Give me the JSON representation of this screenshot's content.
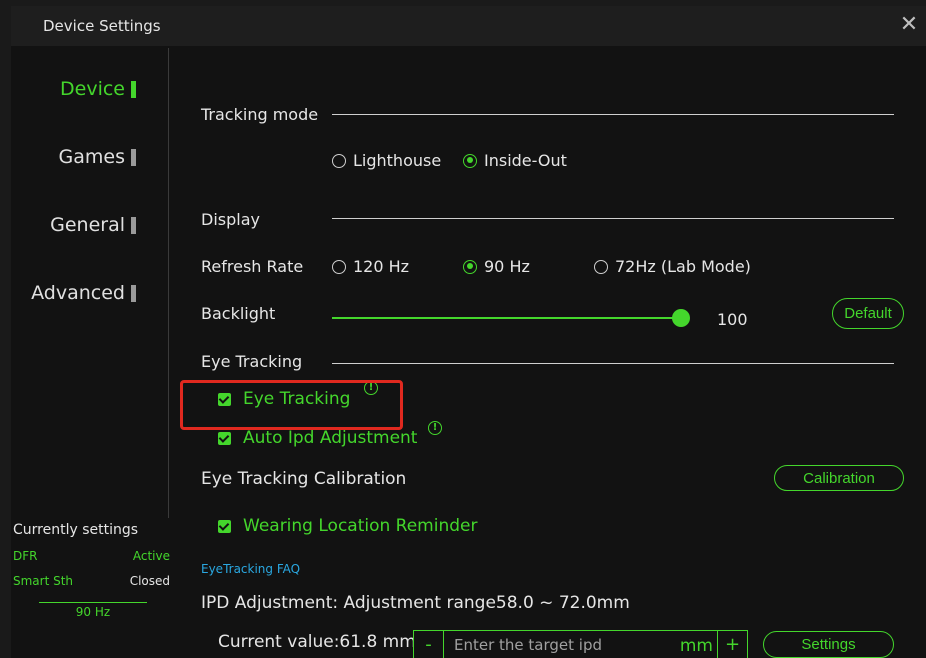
{
  "window": {
    "title": "Device Settings",
    "close_icon": "close-icon"
  },
  "sidebar": {
    "items": [
      {
        "label": "Device",
        "active": true
      },
      {
        "label": "Games",
        "active": false
      },
      {
        "label": "General",
        "active": false
      },
      {
        "label": "Advanced",
        "active": false
      }
    ]
  },
  "current_settings": {
    "heading": "Currently settings",
    "rows": [
      {
        "key": "DFR",
        "value": "Active",
        "value_color": "#44d62c"
      },
      {
        "key": "Smart Sth",
        "value": "Closed",
        "value_color": "#e6e6e6"
      }
    ],
    "refresh": "90 Hz"
  },
  "tracking_mode": {
    "label": "Tracking mode",
    "options": [
      {
        "label": "Lighthouse",
        "selected": false
      },
      {
        "label": "Inside-Out",
        "selected": true
      }
    ]
  },
  "display": {
    "label": "Display",
    "refresh_rate": {
      "label": "Refresh Rate",
      "options": [
        {
          "label": "120 Hz",
          "selected": false
        },
        {
          "label": "90 Hz",
          "selected": true
        },
        {
          "label": "72Hz (Lab Mode)",
          "selected": false
        }
      ]
    },
    "backlight": {
      "label": "Backlight",
      "value": "100",
      "level_percent": 100,
      "default_label": "Default"
    }
  },
  "eye_tracking": {
    "label": "Eye Tracking",
    "eye_tracking_checkbox": {
      "label": "Eye Tracking",
      "checked": true
    },
    "auto_ipd_checkbox": {
      "label": "Auto Ipd Adjustment",
      "checked": true
    },
    "info_glyph": "!",
    "calibration": {
      "label": "Eye Tracking Calibration",
      "button": "Calibration"
    },
    "wearing_reminder": {
      "label": "Wearing Location Reminder",
      "checked": true
    },
    "faq_link": "EyeTracking FAQ"
  },
  "ipd": {
    "adjustment_label": "IPD Adjustment: Adjustment range58.0 ~ 72.0mm",
    "current_value": "Current value:61.8 mm",
    "minus": "-",
    "plus": "+",
    "input_placeholder": "Enter the target ipd",
    "unit": "mm",
    "settings_button": "Settings"
  },
  "colors": {
    "accent": "#44d62c",
    "highlight": "#e0291f",
    "link": "#2aa7e0",
    "background": "#121212"
  }
}
